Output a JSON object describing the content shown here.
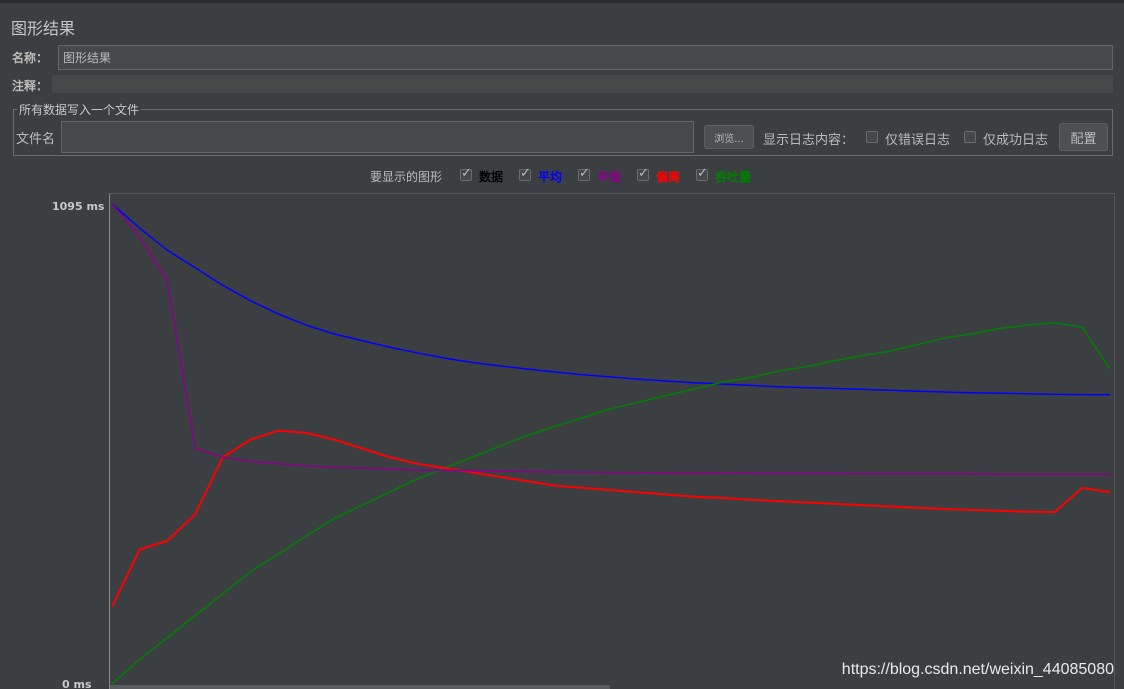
{
  "panel": {
    "title": "图形结果"
  },
  "name_row": {
    "label": "名称：",
    "value": "图形结果"
  },
  "comment_row": {
    "label": "注释：",
    "value": ""
  },
  "file_group": {
    "legend": "所有数据写入一个文件",
    "file_label": "文件名",
    "file_value": "",
    "browse_label": "浏览...",
    "log_label": "显示日志内容：",
    "errors_only_label": "仅错误日志",
    "success_only_label": "仅成功日志",
    "configure_label": "配置"
  },
  "graph_toggles": {
    "label": "要显示的图形",
    "items": [
      {
        "label": "数据",
        "checked": true,
        "color": "#000000"
      },
      {
        "label": "平均",
        "checked": true,
        "color": "#0000ff"
      },
      {
        "label": "中值",
        "checked": true,
        "color": "#8b008b"
      },
      {
        "label": "偏离",
        "checked": true,
        "color": "#ff0000"
      },
      {
        "label": "吞吐量",
        "checked": true,
        "color": "#008000"
      }
    ]
  },
  "chart_data": {
    "type": "line",
    "y_ticks": [
      "1095",
      "0"
    ],
    "y_unit": "ms",
    "ylim": [
      0,
      1095
    ],
    "series": [
      {
        "color": "#0000ff",
        "values": [
          1095,
          1040,
          990,
          950,
          910,
          875,
          845,
          820,
          800,
          785,
          770,
          757,
          745,
          735,
          727,
          720,
          713,
          707,
          702,
          697,
          693,
          689,
          686,
          683,
          680,
          678,
          676,
          674,
          672,
          670,
          668,
          666,
          665,
          664,
          663,
          662,
          662
        ]
      },
      {
        "color": "#008000",
        "values": [
          5,
          60,
          110,
          160,
          210,
          260,
          300,
          340,
          380,
          410,
          440,
          470,
          495,
          520,
          545,
          570,
          590,
          610,
          630,
          645,
          660,
          675,
          690,
          700,
          715,
          725,
          738,
          750,
          760,
          775,
          790,
          800,
          812,
          820,
          825,
          815,
          720
        ]
      },
      {
        "color": "#ff0000",
        "values": [
          180,
          310,
          330,
          390,
          520,
          560,
          580,
          575,
          560,
          540,
          520,
          505,
          495,
          485,
          475,
          465,
          455,
          450,
          445,
          440,
          435,
          430,
          427,
          423,
          420,
          417,
          414,
          411,
          408,
          405,
          402,
          400,
          398,
          396,
          395,
          450,
          440
        ]
      },
      {
        "color": "#8b008b",
        "values": [
          1095,
          1020,
          920,
          540,
          520,
          510,
          505,
          500,
          497,
          495,
          493,
          491,
          490,
          489,
          488,
          487,
          486,
          486,
          485,
          485,
          484,
          484,
          484,
          483,
          483,
          483,
          483,
          482,
          482,
          482,
          482,
          482,
          481,
          481,
          481,
          481,
          481
        ]
      }
    ]
  },
  "watermark": "https://blog.csdn.net/weixin_44085080"
}
